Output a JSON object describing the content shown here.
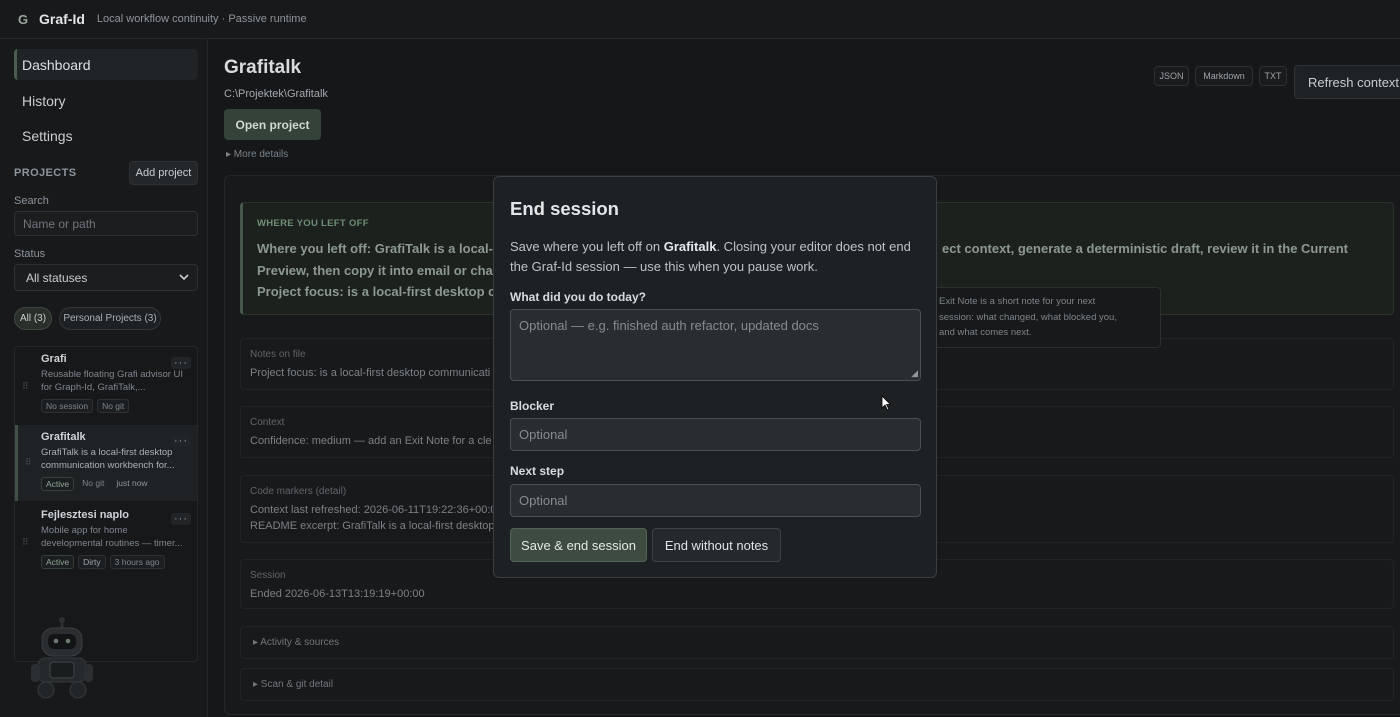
{
  "app": {
    "logo_glyph": "G",
    "name": "Graf-Id",
    "tagline": "Local workflow continuity · Passive runtime"
  },
  "sidebar": {
    "nav": [
      {
        "label": "Dashboard",
        "active": true
      },
      {
        "label": "History",
        "active": false
      },
      {
        "label": "Settings",
        "active": false
      }
    ],
    "projects_heading": "PROJECTS",
    "add_project_label": "Add project",
    "search_label": "Search",
    "search_placeholder": "Name or path",
    "status_label": "Status",
    "status_value": "All statuses",
    "filters": [
      {
        "label": "All (3)",
        "active": true
      },
      {
        "label": "Personal Projects (3)",
        "active": false
      }
    ],
    "projects": [
      {
        "name": "Grafi",
        "description": "Reusable floating Grafi advisor UI for Graph-Id, GrafiTalk,...",
        "tags": [
          "No session",
          "No git"
        ],
        "time": ""
      },
      {
        "name": "Grafitalk",
        "description": "GrafiTalk is a local-first desktop communication workbench for...",
        "tags": [
          "Active",
          "No git"
        ],
        "time": "just now"
      },
      {
        "name": "Fejlesztesi naplo",
        "description": "Mobile app for home developmental routines — timer...",
        "tags": [
          "Active",
          "Dirty"
        ],
        "time": "3 hours ago"
      }
    ],
    "menu_glyph": "···"
  },
  "main": {
    "title": "Grafitalk",
    "path": "C:\\Projektek\\Grafitalk",
    "open_label": "Open project",
    "more_details": "▸ More details",
    "formats": [
      "JSON",
      "Markdown",
      "TXT"
    ],
    "refresh_label": "Refresh context",
    "where_left_off": {
      "heading": "WHERE YOU LEFT OFF",
      "line1_left": "Where you left off: GrafiTalk is a local-",
      "line1_right": "ect context, generate a deterministic draft, review it in the Current",
      "line2": "Preview, then copy it into email or cha",
      "line3": "Project focus: is a local-first desktop co"
    },
    "notes": {
      "label": "Notes on file",
      "text": "Project focus: is a local-first desktop communicati"
    },
    "context": {
      "label": "Context",
      "text": "Confidence: medium — add an Exit Note for a cle"
    },
    "code_markers": {
      "label": "Code markers (detail)",
      "line1": "Context last refreshed: 2026-06-11T19:22:36+00:00",
      "line2": "README excerpt: GrafiTalk is a local-first desktop co"
    },
    "session": {
      "label": "Session",
      "text": "Ended 2026-06-13T13:19:19+00:00"
    },
    "activity_label": "▸ Activity & sources",
    "scan_label": "▸ Scan & git detail"
  },
  "tooltip": {
    "line1": "Exit Note is a short note for your next",
    "line2": "session: what changed, what blocked you,",
    "line3": "and what comes next."
  },
  "modal": {
    "title": "End session",
    "desc_prefix": "Save where you left off on ",
    "desc_project": "Grafitalk",
    "desc_suffix": ". Closing your editor does not end the Graf-Id session — use this when you pause work.",
    "today_label": "What did you do today?",
    "today_placeholder": "Optional — e.g. finished auth refactor, updated docs",
    "blocker_label": "Blocker",
    "blocker_placeholder": "Optional",
    "next_label": "Next step",
    "next_placeholder": "Optional",
    "save_label": "Save & end session",
    "end_label": "End without notes"
  }
}
